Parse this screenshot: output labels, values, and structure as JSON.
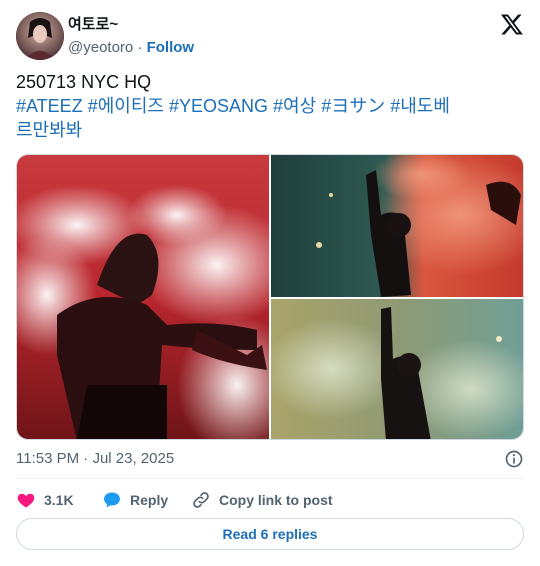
{
  "author": {
    "display_name": "여토로~",
    "handle": "@yeotoro",
    "separator": "·",
    "follow_label": "Follow"
  },
  "post": {
    "line1": "250713 NYC HQ",
    "hashtags": [
      "#ATEEZ",
      "#에이티즈",
      "#YEOSANG",
      "#여상",
      "#ヨサン",
      "#내도베르만봐봐"
    ],
    "hashtag_line1": [
      "#ATEEZ",
      "#에이티즈",
      "#YEOSANG",
      "#여상",
      "#ヨサン",
      "#내도베"
    ],
    "hashtag_line2": "르만봐봐"
  },
  "meta": {
    "time": "11:53 PM",
    "separator": "·",
    "date": "Jul 23, 2025"
  },
  "actions": {
    "like_count": "3.1K",
    "reply_label": "Reply",
    "copy_label": "Copy link to post"
  },
  "read_replies_label": "Read 6 replies",
  "colors": {
    "link": "#1d6fb8",
    "like": "#f91880",
    "reply": "#1d9bf0",
    "muted": "#536471"
  }
}
